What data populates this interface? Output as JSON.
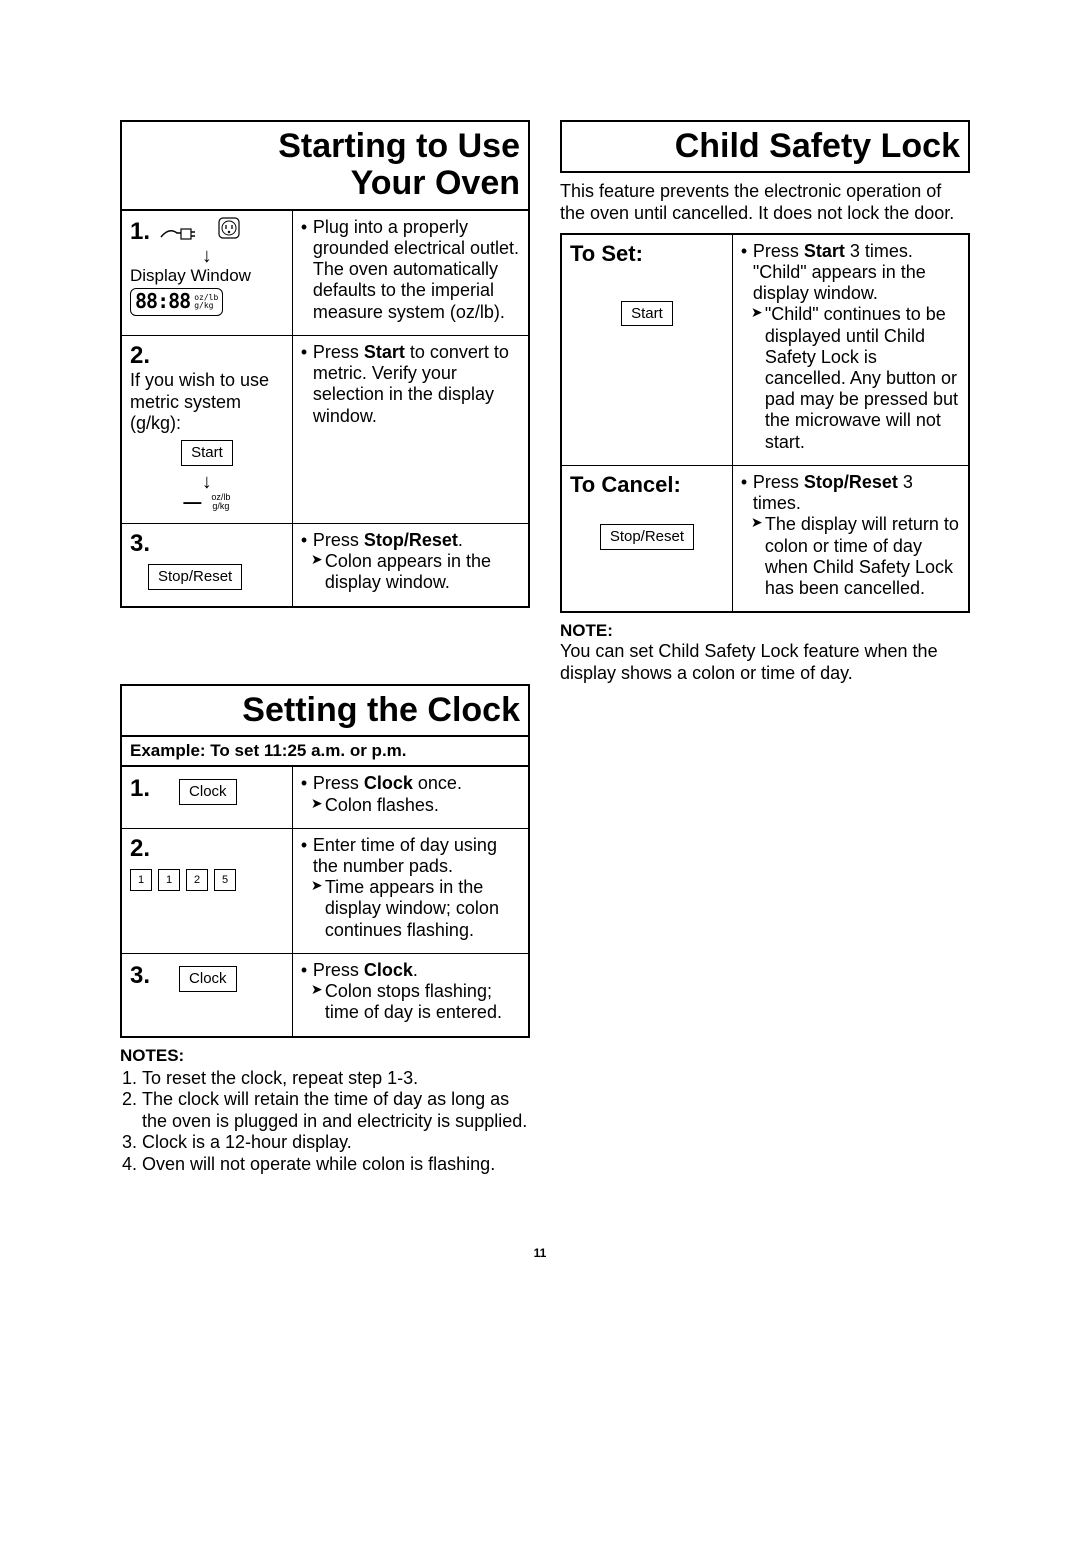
{
  "page_number": "11",
  "left_col": {
    "starting": {
      "title_l1": "Starting to Use",
      "title_l2": "Your Oven",
      "step1": {
        "num": "1.",
        "display_window_label": "Display Window",
        "display_value": "88:88",
        "unit_top": "oz/lb",
        "unit_bot": "g/kg",
        "r1": "Plug into a properly grounded electrical outlet.",
        "r1b": "The oven automatically defaults to the imperial measure system (oz/lb)."
      },
      "step2": {
        "num": "2.",
        "lead": "If you wish to use metric system (g/kg):",
        "btn": "Start",
        "unit_top": "oz/lb",
        "unit_bot": "g/kg",
        "r_pre": "Press ",
        "r_bold": "Start",
        "r_post": " to convert to metric. Verify your selection in the display window."
      },
      "step3": {
        "num": "3.",
        "btn": "Stop/Reset",
        "r_pre": "Press ",
        "r_bold": "Stop/Reset",
        "r_post": ".",
        "sub": "Colon appears in the display window."
      }
    },
    "clock": {
      "title": "Setting the Clock",
      "example": "Example: To set 11:25 a.m. or p.m.",
      "s1": {
        "num": "1.",
        "btn": "Clock",
        "r_pre": "Press ",
        "r_bold": "Clock",
        "r_post": " once.",
        "sub": "Colon flashes."
      },
      "s2": {
        "num": "2.",
        "digits": [
          "1",
          "1",
          "2",
          "5"
        ],
        "r1": "Enter time of day using the number pads.",
        "sub": "Time appears in the display window; colon continues flashing."
      },
      "s3": {
        "num": "3.",
        "btn": "Clock",
        "r_pre": "Press ",
        "r_bold": "Clock",
        "r_post": ".",
        "sub": "Colon stops flashing; time of day is entered."
      },
      "notes_label": "NOTES:",
      "notes": [
        "To reset the clock, repeat step 1-3.",
        "The clock will retain the time of day as long as the oven is plugged in and electricity is supplied.",
        "Clock is a 12-hour display.",
        "Oven will not operate while colon is flashing."
      ]
    }
  },
  "right_col": {
    "child": {
      "title": "Child Safety Lock",
      "intro": "This feature prevents the electronic operation of the oven until cancelled. It does not lock the door.",
      "set": {
        "label": "To Set:",
        "btn": "Start",
        "r_pre": "Press ",
        "r_bold": "Start",
        "r_post": " 3 times. \"Child\" appears in the display window.",
        "sub": "\"Child\" continues to be displayed until Child Safety Lock is cancelled. Any button or pad may be pressed but the microwave will not start."
      },
      "cancel": {
        "label": "To Cancel:",
        "btn": "Stop/Reset",
        "r_pre": "Press ",
        "r_bold": "Stop/Reset",
        "r_post": " 3 times.",
        "sub": "The display will return to colon or time of day when Child Safety Lock has been cancelled."
      },
      "note_label": "NOTE:",
      "note": "You can set Child Safety Lock feature when the display shows a colon or time of day."
    }
  }
}
